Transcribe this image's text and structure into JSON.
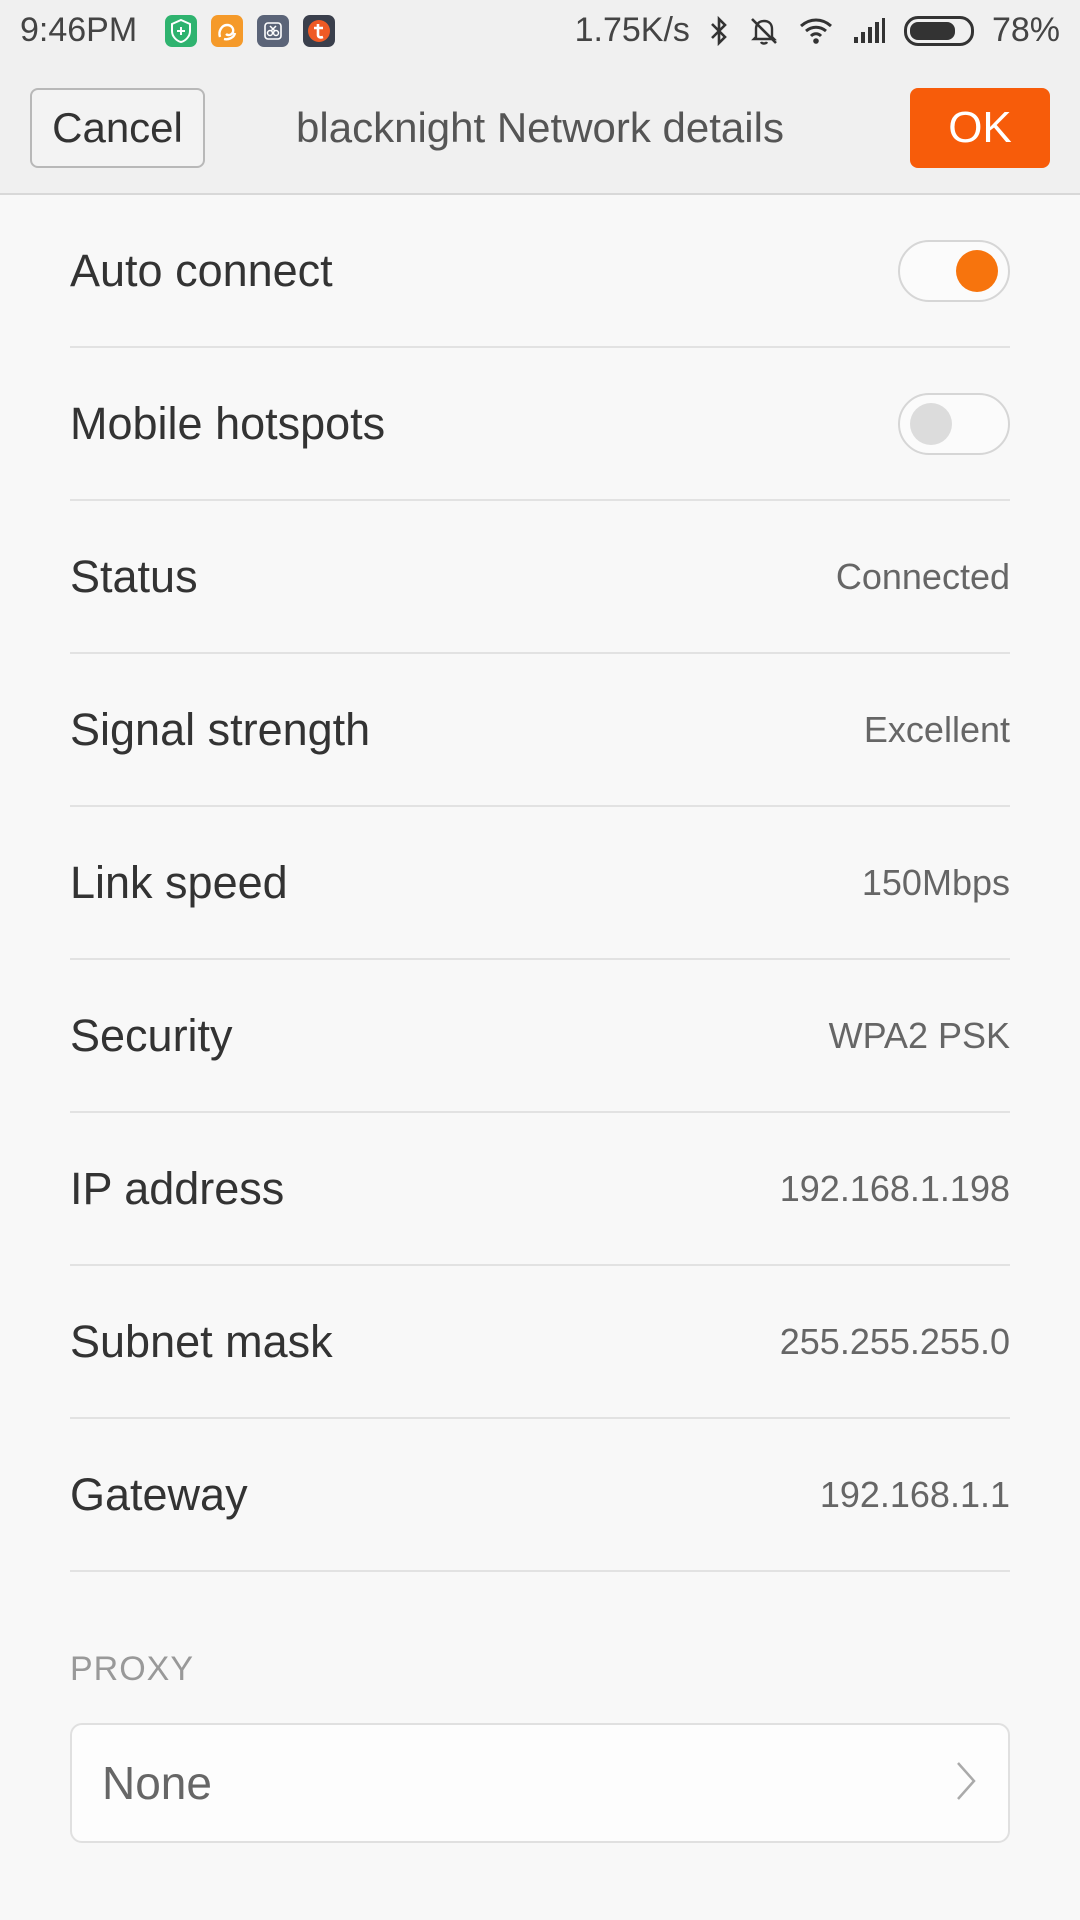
{
  "status_bar": {
    "time": "9:46PM",
    "speed": "1.75K/s",
    "battery": "78%",
    "battery_level": 0.78,
    "apps": [
      {
        "name": "shield-app-icon",
        "color": "#2fb36f",
        "glyph": "+"
      },
      {
        "name": "uc-browser-app-icon",
        "color": "#f59a2a",
        "glyph": "U"
      },
      {
        "name": "tool-app-icon",
        "color": "#5b6478",
        "glyph": "✂"
      },
      {
        "name": "t-app-icon",
        "color": "#ef5a25",
        "glyph": "t"
      }
    ]
  },
  "header": {
    "cancel_label": "Cancel",
    "title": "blacknight Network details",
    "ok_label": "OK",
    "accent": "#f75c0a"
  },
  "toggles": {
    "auto_connect": {
      "label": "Auto connect",
      "on": true
    },
    "mobile_hotspots": {
      "label": "Mobile hotspots",
      "on": false
    }
  },
  "details": [
    {
      "label": "Status",
      "value": "Connected"
    },
    {
      "label": "Signal strength",
      "value": "Excellent"
    },
    {
      "label": "Link speed",
      "value": "150Mbps"
    },
    {
      "label": "Security",
      "value": "WPA2 PSK"
    },
    {
      "label": "IP address",
      "value": "192.168.1.198"
    },
    {
      "label": "Subnet mask",
      "value": "255.255.255.0"
    },
    {
      "label": "Gateway",
      "value": "192.168.1.1"
    }
  ],
  "proxy": {
    "header": "PROXY",
    "value": "None"
  }
}
